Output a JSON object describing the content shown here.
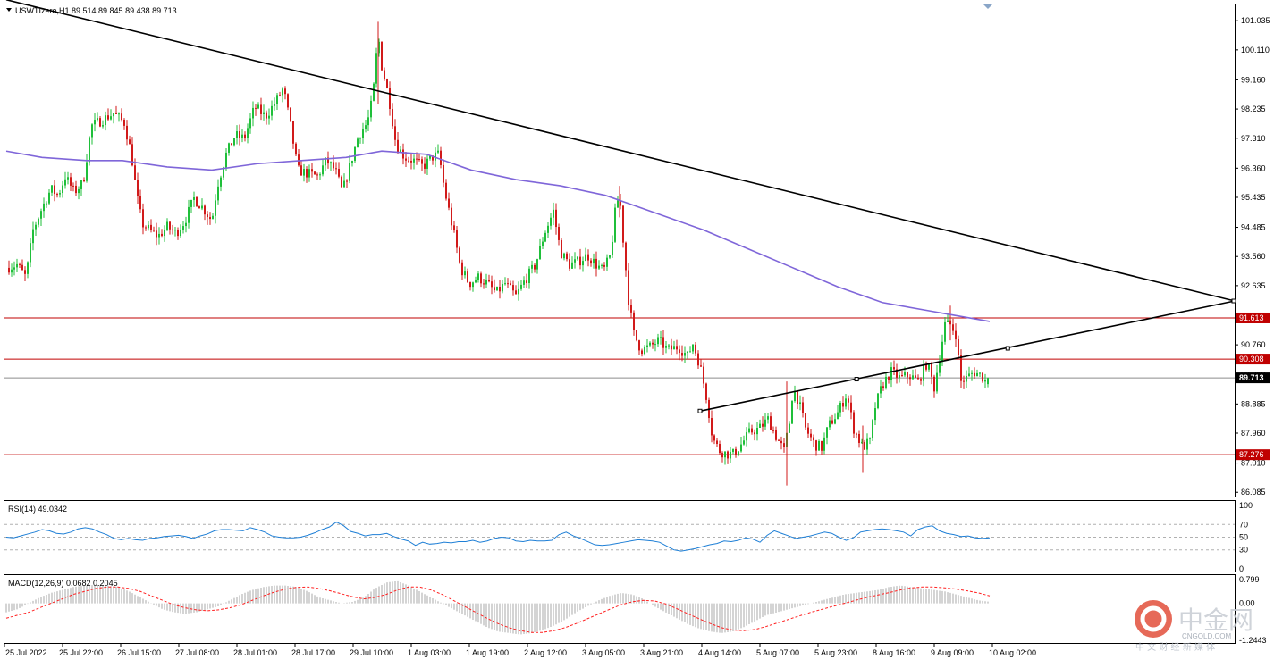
{
  "header": {
    "symbol_line": "USWTIzero,H1  89.514 89.845 89.438 89.713"
  },
  "chart_data": [
    {
      "type": "candlestick",
      "symbol": "USWTIzero",
      "timeframe": "H1",
      "ohlc_last": {
        "open": 89.514,
        "high": 89.845,
        "low": 89.438,
        "close": 89.713
      },
      "current_price_label": "89.713",
      "y_ticks": [
        "101.035",
        "100.110",
        "99.160",
        "98.235",
        "97.310",
        "96.360",
        "95.435",
        "94.485",
        "93.560",
        "92.635",
        "91.685",
        "90.760",
        "89.810",
        "88.885",
        "87.960",
        "87.010",
        "86.085"
      ],
      "ylim": [
        85.95,
        101.55
      ],
      "x_ticks": [
        "25 Jul 2022",
        "25 Jul 22:00",
        "26 Jul 15:00",
        "27 Jul 08:00",
        "28 Jul 01:00",
        "28 Jul 17:00",
        "29 Jul 10:00",
        "1 Aug 03:00",
        "1 Aug 19:00",
        "2 Aug 12:00",
        "3 Aug 05:00",
        "3 Aug 21:00",
        "4 Aug 14:00",
        "5 Aug 07:00",
        "5 Aug 23:00",
        "8 Aug 16:00",
        "9 Aug 09:00",
        "10 Aug 02:00"
      ],
      "horizontal_levels": [
        {
          "value": 91.613,
          "label": "91.613",
          "color": "#c00000"
        },
        {
          "value": 90.308,
          "label": "90.308",
          "color": "#c00000"
        },
        {
          "value": 87.276,
          "label": "87.276",
          "color": "#c00000"
        }
      ],
      "price_path": [
        [
          0,
          93.2
        ],
        [
          12,
          93.3
        ],
        [
          22,
          92.9
        ],
        [
          30,
          94.4
        ],
        [
          40,
          95.1
        ],
        [
          50,
          95.7
        ],
        [
          58,
          95.5
        ],
        [
          66,
          96.1
        ],
        [
          76,
          95.6
        ],
        [
          86,
          95.9
        ],
        [
          95,
          97.7
        ],
        [
          108,
          97.9
        ],
        [
          120,
          98.1
        ],
        [
          132,
          97.8
        ],
        [
          140,
          96.8
        ],
        [
          146,
          95.5
        ],
        [
          152,
          94.6
        ],
        [
          160,
          94.4
        ],
        [
          170,
          94.2
        ],
        [
          180,
          94.5
        ],
        [
          190,
          94.3
        ],
        [
          200,
          94.7
        ],
        [
          210,
          95.4
        ],
        [
          220,
          95.1
        ],
        [
          230,
          94.7
        ],
        [
          236,
          95.8
        ],
        [
          246,
          96.8
        ],
        [
          256,
          97.4
        ],
        [
          266,
          97.3
        ],
        [
          278,
          98.3
        ],
        [
          290,
          98.0
        ],
        [
          300,
          98.4
        ],
        [
          310,
          98.9
        ],
        [
          318,
          97.7
        ],
        [
          326,
          96.3
        ],
        [
          336,
          96.2
        ],
        [
          348,
          96.1
        ],
        [
          358,
          96.6
        ],
        [
          368,
          96.3
        ],
        [
          376,
          95.6
        ],
        [
          384,
          96.4
        ],
        [
          394,
          97.4
        ],
        [
          404,
          97.8
        ],
        [
          410,
          98.6
        ],
        [
          416,
          100.6
        ],
        [
          420,
          99.6
        ],
        [
          428,
          98.6
        ],
        [
          436,
          97.1
        ],
        [
          446,
          96.7
        ],
        [
          456,
          96.6
        ],
        [
          466,
          96.4
        ],
        [
          476,
          96.7
        ],
        [
          484,
          96.8
        ],
        [
          490,
          95.7
        ],
        [
          496,
          94.9
        ],
        [
          502,
          94.1
        ],
        [
          508,
          93.2
        ],
        [
          518,
          92.7
        ],
        [
          528,
          92.9
        ],
        [
          538,
          92.7
        ],
        [
          548,
          92.4
        ],
        [
          558,
          92.7
        ],
        [
          570,
          92.3
        ],
        [
          580,
          92.8
        ],
        [
          592,
          93.3
        ],
        [
          602,
          94.3
        ],
        [
          612,
          95.0
        ],
        [
          620,
          93.7
        ],
        [
          630,
          93.3
        ],
        [
          640,
          93.4
        ],
        [
          650,
          93.6
        ],
        [
          660,
          93.3
        ],
        [
          668,
          93.1
        ],
        [
          676,
          93.6
        ],
        [
          682,
          95.2
        ],
        [
          686,
          95.5
        ],
        [
          690,
          94.1
        ],
        [
          696,
          92.2
        ],
        [
          702,
          91.1
        ],
        [
          710,
          90.6
        ],
        [
          720,
          90.7
        ],
        [
          730,
          90.9
        ],
        [
          740,
          90.6
        ],
        [
          752,
          90.7
        ],
        [
          762,
          90.4
        ],
        [
          768,
          90.8
        ],
        [
          776,
          90.1
        ],
        [
          784,
          89.0
        ],
        [
          790,
          87.8
        ],
        [
          798,
          87.4
        ],
        [
          806,
          87.3
        ],
        [
          814,
          87.3
        ],
        [
          822,
          87.6
        ],
        [
          832,
          88.0
        ],
        [
          842,
          88.1
        ],
        [
          852,
          88.4
        ],
        [
          862,
          87.8
        ],
        [
          870,
          87.4
        ],
        [
          876,
          88.3
        ],
        [
          880,
          89.4
        ],
        [
          886,
          89.0
        ],
        [
          894,
          88.1
        ],
        [
          904,
          87.6
        ],
        [
          912,
          87.5
        ],
        [
          920,
          88.2
        ],
        [
          930,
          88.6
        ],
        [
          940,
          89.2
        ],
        [
          948,
          88.1
        ],
        [
          958,
          87.5
        ],
        [
          966,
          87.7
        ],
        [
          972,
          88.8
        ],
        [
          980,
          89.5
        ],
        [
          990,
          89.9
        ],
        [
          1000,
          89.7
        ],
        [
          1010,
          89.8
        ],
        [
          1020,
          89.6
        ],
        [
          1030,
          90.2
        ],
        [
          1038,
          89.4
        ],
        [
          1044,
          90.4
        ],
        [
          1050,
          91.4
        ],
        [
          1056,
          91.4
        ],
        [
          1062,
          91.1
        ],
        [
          1068,
          89.6
        ],
        [
          1074,
          89.7
        ],
        [
          1082,
          89.9
        ],
        [
          1090,
          89.8
        ],
        [
          1096,
          89.6
        ],
        [
          1100,
          89.71
        ]
      ],
      "moving_average": {
        "color": "#7f66d9",
        "points": [
          [
            0,
            96.9
          ],
          [
            40,
            96.7
          ],
          [
            90,
            96.6
          ],
          [
            130,
            96.6
          ],
          [
            180,
            96.4
          ],
          [
            230,
            96.3
          ],
          [
            280,
            96.5
          ],
          [
            330,
            96.6
          ],
          [
            380,
            96.7
          ],
          [
            420,
            96.9
          ],
          [
            470,
            96.8
          ],
          [
            520,
            96.3
          ],
          [
            570,
            96.0
          ],
          [
            620,
            95.8
          ],
          [
            670,
            95.5
          ],
          [
            700,
            95.2
          ],
          [
            740,
            94.8
          ],
          [
            780,
            94.4
          ],
          [
            830,
            93.8
          ],
          [
            880,
            93.2
          ],
          [
            930,
            92.6
          ],
          [
            980,
            92.1
          ],
          [
            1030,
            91.85
          ],
          [
            1060,
            91.7
          ],
          [
            1100,
            91.5
          ]
        ]
      },
      "trendlines": [
        {
          "from": [
            0,
            101.7
          ],
          "to": [
            1380,
            92.15
          ],
          "color": "#000000"
        },
        {
          "from": [
            776,
            88.66
          ],
          "to": [
            1380,
            92.15
          ],
          "color": "#000000"
        }
      ]
    },
    {
      "type": "line",
      "indicator": "RSI",
      "header": "RSI(14) 49.0342",
      "ylim": [
        0,
        100
      ],
      "y_ticks": [
        "100",
        "70",
        "50",
        "30",
        "0"
      ],
      "levels": [
        70,
        50,
        30
      ],
      "series": [
        {
          "name": "RSI(14)",
          "color": "#1e7fd6",
          "values": [
            50,
            49,
            52,
            55,
            58,
            62,
            60,
            56,
            55,
            58,
            63,
            65,
            63,
            58,
            54,
            48,
            46,
            48,
            46,
            45,
            48,
            49,
            51,
            52,
            53,
            51,
            48,
            52,
            55,
            60,
            62,
            62,
            61,
            60,
            65,
            62,
            58,
            52,
            50,
            49,
            49,
            50,
            53,
            57,
            62,
            66,
            74,
            68,
            59,
            56,
            52,
            54,
            54,
            56,
            51,
            47,
            44,
            37,
            42,
            39,
            40,
            42,
            41,
            43,
            43,
            45,
            42,
            44,
            48,
            50,
            49,
            44,
            43,
            45,
            44,
            44,
            45,
            54,
            58,
            52,
            48,
            43,
            38,
            37,
            38,
            40,
            42,
            44,
            46,
            45,
            44,
            42,
            36,
            30,
            28,
            30,
            32,
            35,
            38,
            40,
            44,
            43,
            45,
            49,
            47,
            42,
            53,
            60,
            56,
            52,
            48,
            50,
            52,
            55,
            58,
            56,
            50,
            45,
            49,
            58,
            60,
            62,
            63,
            62,
            60,
            58,
            52,
            62,
            66,
            68,
            60,
            56,
            54,
            51,
            52,
            49,
            48,
            49
          ]
        }
      ]
    },
    {
      "type": "bar+line",
      "indicator": "MACD",
      "header": "MACD(12,26,9) 0.0682 0.2045",
      "ylim": [
        -1.2443,
        0.799
      ],
      "y_ticks": [
        "0.799",
        "0.00",
        "-1.2443"
      ],
      "series": [
        {
          "name": "MACD",
          "color": "#a9a9a9",
          "values": [
            -0.3,
            -0.2,
            0.0,
            0.2,
            0.35,
            0.45,
            0.55,
            0.6,
            0.62,
            0.6,
            0.55,
            0.4,
            0.2,
            0.0,
            -0.2,
            -0.3,
            -0.35,
            -0.3,
            -0.2,
            -0.1,
            0.1,
            0.3,
            0.45,
            0.55,
            0.6,
            0.6,
            0.55,
            0.4,
            0.2,
            0.1,
            0.0,
            0.05,
            0.2,
            0.5,
            0.7,
            0.75,
            0.6,
            0.4,
            0.2,
            0.0,
            -0.2,
            -0.4,
            -0.6,
            -0.8,
            -0.95,
            -1.0,
            -1.05,
            -1.0,
            -0.9,
            -0.75,
            -0.55,
            -0.3,
            -0.1,
            0.1,
            0.25,
            0.35,
            0.3,
            0.15,
            -0.1,
            -0.3,
            -0.5,
            -0.7,
            -0.85,
            -0.95,
            -1.0,
            -0.95,
            -0.8,
            -0.6,
            -0.4,
            -0.3,
            -0.2,
            -0.1,
            0.0,
            0.1,
            0.2,
            0.3,
            0.35,
            0.4,
            0.45,
            0.55,
            0.6,
            0.55,
            0.5,
            0.45,
            0.4,
            0.3,
            0.2,
            0.1,
            0.05
          ]
        },
        {
          "name": "Signal",
          "color": "#ff2020",
          "values": [
            -0.5,
            -0.4,
            -0.3,
            -0.15,
            0.0,
            0.15,
            0.3,
            0.4,
            0.5,
            0.55,
            0.55,
            0.5,
            0.4,
            0.25,
            0.1,
            -0.05,
            -0.15,
            -0.22,
            -0.25,
            -0.22,
            -0.15,
            -0.05,
            0.1,
            0.25,
            0.38,
            0.48,
            0.54,
            0.55,
            0.5,
            0.42,
            0.32,
            0.22,
            0.15,
            0.2,
            0.3,
            0.45,
            0.55,
            0.55,
            0.45,
            0.3,
            0.1,
            -0.1,
            -0.3,
            -0.5,
            -0.68,
            -0.82,
            -0.92,
            -0.98,
            -0.98,
            -0.92,
            -0.82,
            -0.68,
            -0.52,
            -0.36,
            -0.2,
            -0.05,
            0.05,
            0.1,
            0.08,
            -0.02,
            -0.18,
            -0.35,
            -0.52,
            -0.68,
            -0.82,
            -0.9,
            -0.92,
            -0.88,
            -0.78,
            -0.66,
            -0.54,
            -0.42,
            -0.3,
            -0.2,
            -0.1,
            0.0,
            0.1,
            0.2,
            0.28,
            0.36,
            0.45,
            0.52,
            0.55,
            0.55,
            0.52,
            0.48,
            0.42,
            0.35,
            0.25
          ]
        }
      ]
    }
  ],
  "watermark": {
    "logo_text": "中金网",
    "logo_sub": "中 文 财 经 新 媒 体",
    "logo_url": "CNGOLD.COM",
    "colors": {
      "logo": "#c7ccd3",
      "logo_mark": "#e2503c"
    }
  },
  "colors": {
    "bull": "#1fbf3a",
    "bear": "#d11a1a",
    "level": "#c00000",
    "trend": "#000000",
    "ma": "#7f66d9",
    "rsi": "#1e7fd6",
    "macd_hist": "#a9a9a9",
    "macd_signal": "#ff2020",
    "price_tag": "#000000"
  }
}
